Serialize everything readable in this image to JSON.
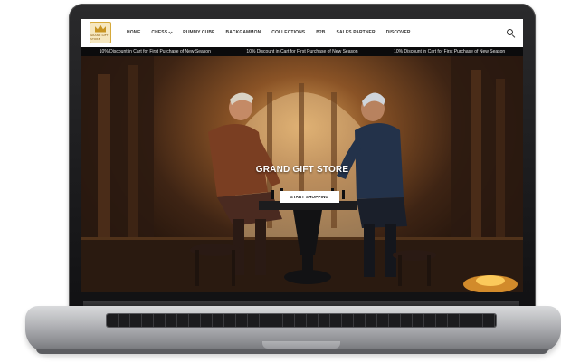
{
  "site": {
    "logo_text": "GRAND GIFT STORE",
    "nav": [
      {
        "label": "HOME"
      },
      {
        "label": "CHESS"
      },
      {
        "label": "RUMMY CUBE"
      },
      {
        "label": "BACKGAMMON"
      },
      {
        "label": "COLLECTIONS"
      },
      {
        "label": "B2B"
      },
      {
        "label": "SALES PARTNER"
      },
      {
        "label": "DISCOVER"
      }
    ],
    "search_icon": "search-icon"
  },
  "announcement": [
    "10% Discount in Cart for First Purchase of New Season",
    "10% Discount in Cart for First Purchase of New Season",
    "10% Discount in Cart for First Purchase of New Season"
  ],
  "hero": {
    "title": "GRAND GIFT STORE",
    "cta": "START SHOPPING"
  },
  "colors": {
    "header_bg": "#ffffff",
    "announce_bg": "#0b0b0c",
    "accent_gold": "#c89422"
  }
}
